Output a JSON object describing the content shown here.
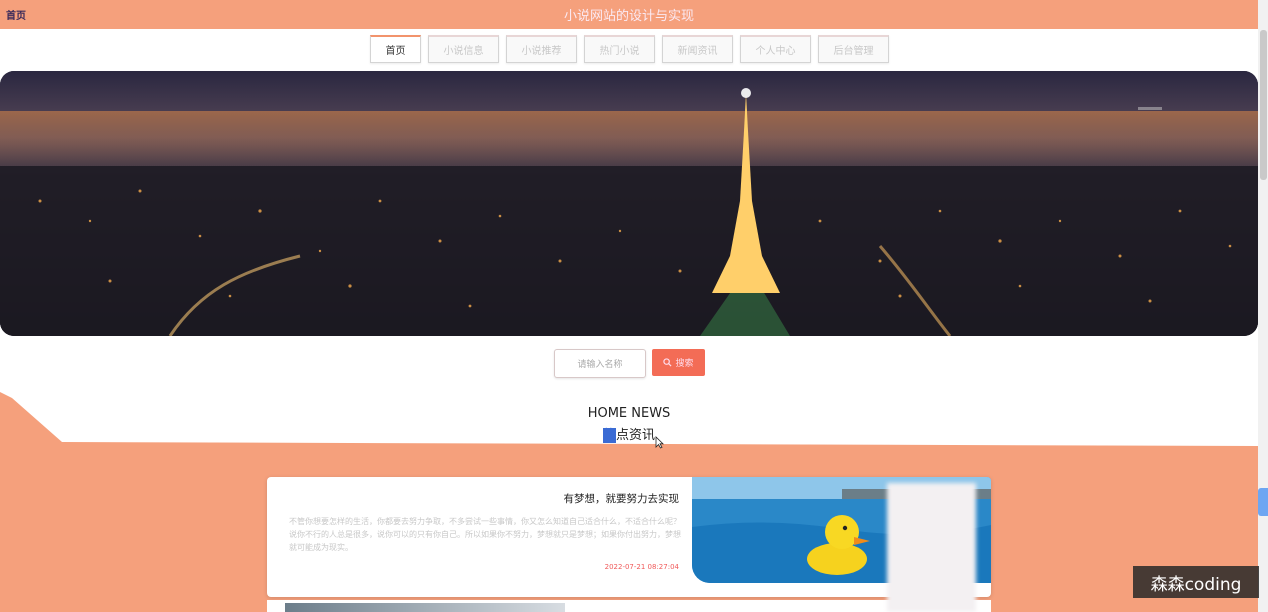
{
  "header": {
    "brand": "首页",
    "title": "小说网站的设计与实现"
  },
  "nav": {
    "items": [
      {
        "label": "首页",
        "active": true
      },
      {
        "label": "小说信息",
        "active": false
      },
      {
        "label": "小说推荐",
        "active": false
      },
      {
        "label": "热门小说",
        "active": false
      },
      {
        "label": "新闻资讯",
        "active": false
      },
      {
        "label": "个人中心",
        "active": false
      },
      {
        "label": "后台管理",
        "active": false
      }
    ]
  },
  "search": {
    "placeholder": "请输入名称",
    "button_label": "搜索",
    "button_icon": "search-icon"
  },
  "news_section": {
    "title_en": "HOME NEWS",
    "title_cn_rest": "点资讯",
    "title_cn_highlighted": "热"
  },
  "news": [
    {
      "title": "有梦想，就要努力去实现",
      "excerpt": "不管你想要怎样的生活，你都要去努力争取，不多尝试一些事情，你又怎么知道自己适合什么，不适合什么呢？说你不行的人总是很多，说你可以的只有你自己。所以如果你不努力，梦想就只是梦想；如果你付出努力，梦想就可能成为现实。",
      "date": "2022-07-21 08:27:04"
    }
  ],
  "watermark": "森森coding",
  "colors": {
    "accent": "#f5a07c",
    "search_button": "#f36c56",
    "date": "#f05a5a"
  }
}
